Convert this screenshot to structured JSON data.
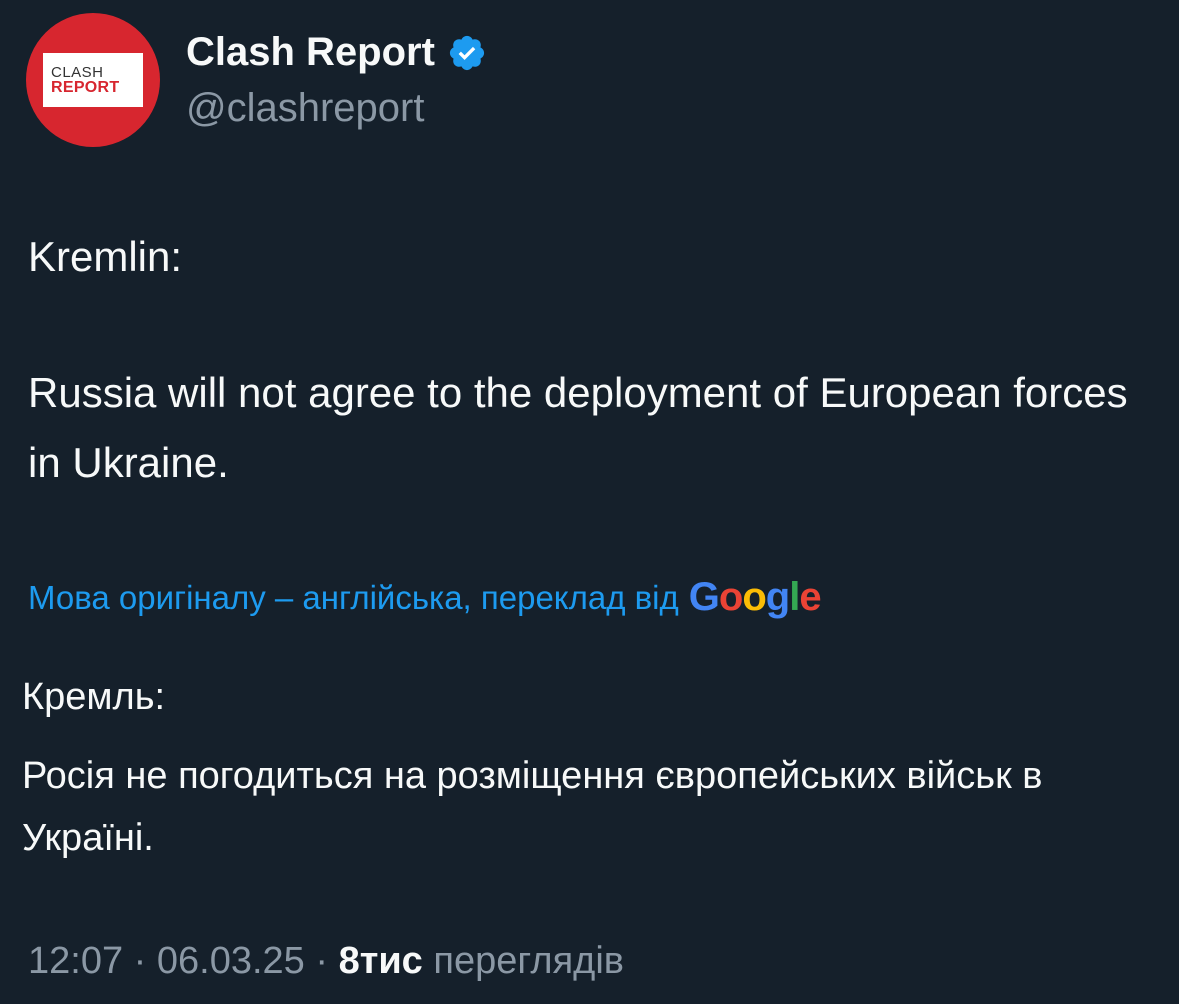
{
  "author": {
    "avatar_top": "CLASH",
    "avatar_bottom": "REPORT",
    "display_name": "Clash Report",
    "verified_icon": "verified-badge-icon",
    "handle": "@clashreport"
  },
  "tweet": {
    "lines": [
      "Kremlin:",
      "Russia will not agree to the deployment of European forces in Ukraine."
    ]
  },
  "translation": {
    "note": "Мова оригіналу – англійська, переклад від",
    "provider": "Google",
    "lines": [
      "Кремль:",
      "Росія не погодиться на розміщення європейських військ в Україні."
    ]
  },
  "meta": {
    "time": "12:07",
    "sep1": "·",
    "date": "06.03.25",
    "sep2": "·",
    "views_count": "8тис",
    "views_label": "переглядів"
  },
  "colors": {
    "background": "#15202b",
    "link": "#1d9bf0",
    "verified": "#1d9bf0",
    "muted": "#8b98a5",
    "avatar": "#d7262f"
  }
}
